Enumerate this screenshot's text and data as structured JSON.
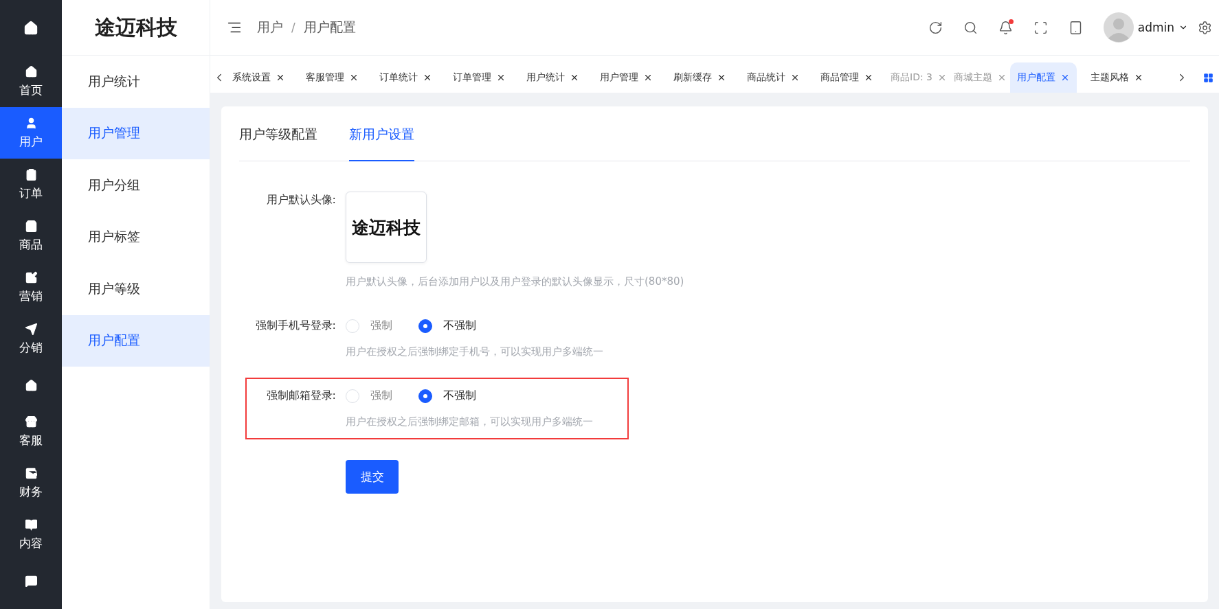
{
  "rail": {
    "items": [
      {
        "label": "首页",
        "selected": false
      },
      {
        "label": "用户",
        "selected": true
      },
      {
        "label": "订单",
        "selected": false
      },
      {
        "label": "商品",
        "selected": false
      },
      {
        "label": "营销",
        "selected": false
      },
      {
        "label": "分销",
        "selected": false
      },
      {
        "selected": false
      },
      {
        "label": "客服",
        "selected": false
      },
      {
        "label": "财务",
        "selected": false
      },
      {
        "label": "内容",
        "selected": false
      },
      {
        "selected": false
      }
    ]
  },
  "submenu": {
    "title": "途迈科技",
    "items": [
      {
        "label": "用户统计",
        "selected": false
      },
      {
        "label": "用户管理",
        "selected": true
      },
      {
        "label": "用户分组",
        "selected": false
      },
      {
        "label": "用户标签",
        "selected": false
      },
      {
        "label": "用户等级",
        "selected": false
      },
      {
        "label": "用户配置",
        "selected": true
      }
    ]
  },
  "header": {
    "breadcrumb": [
      "用户",
      "用户配置"
    ],
    "separator": "/",
    "notification": true,
    "user": "admin"
  },
  "tabs": [
    {
      "label": "系统设置",
      "selected": false,
      "dimmed": false
    },
    {
      "label": "客服管理",
      "selected": false,
      "dimmed": false
    },
    {
      "label": "订单统计",
      "selected": false,
      "dimmed": false
    },
    {
      "label": "订单管理",
      "selected": false,
      "dimmed": false
    },
    {
      "label": "用户统计",
      "selected": false,
      "dimmed": false
    },
    {
      "label": "用户管理",
      "selected": false,
      "dimmed": false
    },
    {
      "label": "刷新缓存",
      "selected": false,
      "dimmed": false
    },
    {
      "label": "商品统计",
      "selected": false,
      "dimmed": false
    },
    {
      "label": "商品管理",
      "selected": false,
      "dimmed": false
    },
    {
      "label": "商品ID: 3",
      "selected": false,
      "dimmed": true
    },
    {
      "label": "商城主题",
      "selected": false,
      "dimmed": true
    },
    {
      "label": "用户配置",
      "selected": true,
      "dimmed": false
    },
    {
      "label": "主题风格",
      "selected": false,
      "dimmed": false
    }
  ],
  "card": {
    "tabs": [
      {
        "label": "用户等级配置",
        "selected": false
      },
      {
        "label": "新用户设置",
        "selected": true
      }
    ],
    "form": [
      {
        "kind": "avatar",
        "label": "用户默认头像:",
        "value": "途迈科技",
        "help": "用户默认头像，后台添加用户以及用户登录的默认头像显示，尺寸(80*80)",
        "highlighted": false
      },
      {
        "kind": "radio",
        "label": "强制手机号登录:",
        "options": [
          {
            "label": "强制",
            "selected": false
          },
          {
            "label": "不强制",
            "selected": true
          }
        ],
        "help": "用户在授权之后强制绑定手机号，可以实现用户多端统一",
        "highlighted": false
      },
      {
        "kind": "radio",
        "label": "强制邮箱登录:",
        "options": [
          {
            "label": "强制",
            "selected": false
          },
          {
            "label": "不强制",
            "selected": true
          }
        ],
        "help": "用户在授权之后强制绑定邮箱，可以实现用户多端统一",
        "highlighted": true
      }
    ],
    "submit": "提交"
  }
}
